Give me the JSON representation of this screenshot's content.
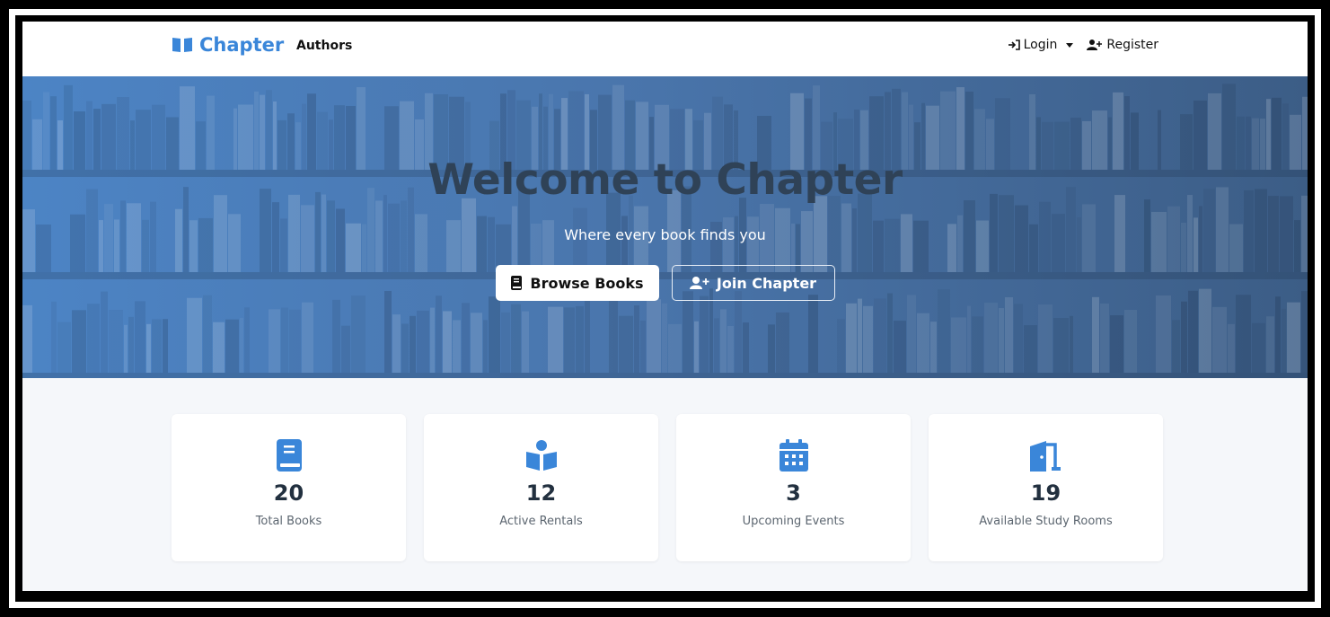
{
  "navbar": {
    "brand": "Chapter",
    "authors": "Authors",
    "login": "Login",
    "register": "Register"
  },
  "hero": {
    "title": "Welcome to Chapter",
    "subtitle": "Where every book finds you",
    "browse_button": "Browse Books",
    "join_button": "Join Chapter"
  },
  "stats": [
    {
      "icon": "book-icon",
      "value": "20",
      "label": "Total Books"
    },
    {
      "icon": "book-reader-icon",
      "value": "12",
      "label": "Active Rentals"
    },
    {
      "icon": "calendar-icon",
      "value": "3",
      "label": "Upcoming Events"
    },
    {
      "icon": "door-open-icon",
      "value": "19",
      "label": "Available Study Rooms"
    }
  ],
  "colors": {
    "brand": "#3a86d9",
    "hero_gradient_start": "#4c84c5",
    "hero_gradient_end": "#3c5d86",
    "title_text": "#2f4257"
  }
}
